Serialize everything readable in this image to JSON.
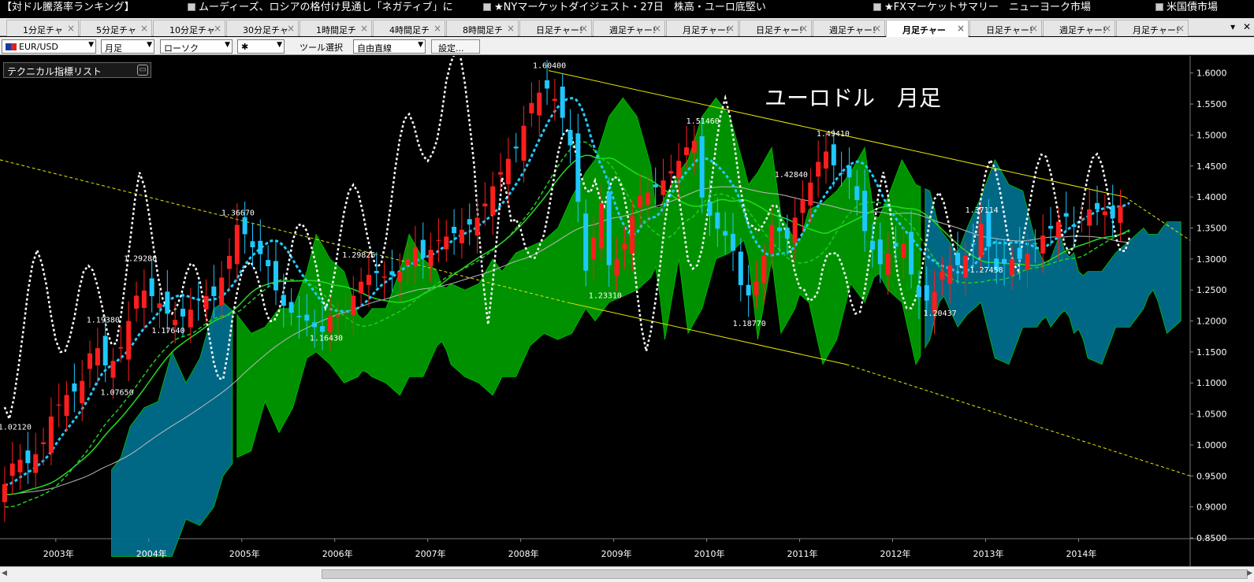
{
  "news": [
    {
      "text": "【対ドル騰落率ランキング】"
    },
    {
      "text": "ムーディーズ、ロシアの格付け見通し「ネガティブ」に"
    },
    {
      "text": "★NYマーケットダイジェスト・27日　株高・ユーロ底堅い"
    },
    {
      "text": "★FXマーケットサマリー　ニューヨーク市場"
    },
    {
      "text": "米国債市場"
    }
  ],
  "tabs": [
    {
      "label": "1分足チャ"
    },
    {
      "label": "5分足チャ"
    },
    {
      "label": "10分足チャ"
    },
    {
      "label": "30分足チャ"
    },
    {
      "label": "1時間足チ"
    },
    {
      "label": "4時間足チ"
    },
    {
      "label": "8時間足チ"
    },
    {
      "label": "日足チャー!"
    },
    {
      "label": "週足チャー!"
    },
    {
      "label": "月足チャー!"
    },
    {
      "label": "日足チャー!"
    },
    {
      "label": "週足チャー!"
    },
    {
      "label": "月足チャー"
    },
    {
      "label": "日足チャー!"
    },
    {
      "label": "週足チャー!"
    },
    {
      "label": "月足チャー!"
    }
  ],
  "active_tab": 12,
  "toolbar": {
    "pair": "EUR/USD",
    "timeframe": "月足",
    "chart_type": "ローソク",
    "marker": "✱",
    "tool_label": "ツール選択",
    "tool": "自由直線",
    "settings": "設定..."
  },
  "indicator_list": "テクニカル指標リスト",
  "chart_title": "ユーロドル　月足",
  "colors": {
    "bull": "#ff1e1e",
    "bear": "#1ec8ff",
    "cloud_green": "#009900",
    "cloud_teal": "#006e8c",
    "trendline": "#e6e600"
  },
  "chart_data": {
    "type": "candlestick",
    "symbol": "EUR/USD",
    "timeframe": "月足",
    "ylim": [
      0.85,
      1.62
    ],
    "x_range": [
      2002.4,
      2015.2
    ],
    "yticks": [
      "1.6000",
      "1.5500",
      "1.5000",
      "1.4500",
      "1.4000",
      "1.3500",
      "1.3000",
      "1.2500",
      "1.2000",
      "1.1500",
      "1.1000",
      "1.0500",
      "1.0000",
      "0.9500",
      "0.9000",
      "0.8500"
    ],
    "xticks": [
      "2003年",
      "2004年",
      "2005年",
      "2006年",
      "2007年",
      "2008年",
      "2009年",
      "2010年",
      "2011年",
      "2012年",
      "2013年",
      "2014年"
    ],
    "annotations": [
      {
        "label": "1.02120",
        "t": 2002.55,
        "v": 1.0212
      },
      {
        "label": "1.07650",
        "t": 2003.65,
        "v": 1.0765
      },
      {
        "label": "1.19380",
        "t": 2003.5,
        "v": 1.1938
      },
      {
        "label": "1.17640",
        "t": 2004.2,
        "v": 1.1764
      },
      {
        "label": "1.29280",
        "t": 2003.9,
        "v": 1.2928
      },
      {
        "label": "1.36670",
        "t": 2004.95,
        "v": 1.3667
      },
      {
        "label": "1.16430",
        "t": 2005.9,
        "v": 1.1643
      },
      {
        "label": "1.29826",
        "t": 2006.25,
        "v": 1.2983
      },
      {
        "label": "1.60400",
        "t": 2008.3,
        "v": 1.604
      },
      {
        "label": "1.23310",
        "t": 2008.9,
        "v": 1.2331
      },
      {
        "label": "1.51460",
        "t": 2009.95,
        "v": 1.5146
      },
      {
        "label": "1.18770",
        "t": 2010.45,
        "v": 1.1877
      },
      {
        "label": "1.42840",
        "t": 2010.9,
        "v": 1.4284
      },
      {
        "label": "1.49410",
        "t": 2011.35,
        "v": 1.4941
      },
      {
        "label": "1.20437",
        "t": 2012.5,
        "v": 1.2044
      },
      {
        "label": "1.37114",
        "t": 2012.95,
        "v": 1.3711
      },
      {
        "label": "1.27458",
        "t": 2013.0,
        "v": 1.2746
      }
    ],
    "close_path": [
      [
        2002.45,
        0.92
      ],
      [
        2002.6,
        0.98
      ],
      [
        2002.75,
        0.97
      ],
      [
        2002.9,
        1.0
      ],
      [
        2003.0,
        1.05
      ],
      [
        2003.15,
        1.08
      ],
      [
        2003.3,
        1.09
      ],
      [
        2003.45,
        1.17
      ],
      [
        2003.6,
        1.12
      ],
      [
        2003.75,
        1.16
      ],
      [
        2003.9,
        1.24
      ],
      [
        2004.0,
        1.25
      ],
      [
        2004.15,
        1.23
      ],
      [
        2004.3,
        1.2
      ],
      [
        2004.45,
        1.21
      ],
      [
        2004.6,
        1.24
      ],
      [
        2004.75,
        1.24
      ],
      [
        2004.9,
        1.3
      ],
      [
        2005.0,
        1.36
      ],
      [
        2005.15,
        1.32
      ],
      [
        2005.3,
        1.3
      ],
      [
        2005.45,
        1.23
      ],
      [
        2005.6,
        1.21
      ],
      [
        2005.75,
        1.2
      ],
      [
        2005.9,
        1.18
      ],
      [
        2006.0,
        1.21
      ],
      [
        2006.15,
        1.21
      ],
      [
        2006.3,
        1.26
      ],
      [
        2006.45,
        1.28
      ],
      [
        2006.6,
        1.27
      ],
      [
        2006.75,
        1.28
      ],
      [
        2006.9,
        1.32
      ],
      [
        2007.0,
        1.3
      ],
      [
        2007.15,
        1.33
      ],
      [
        2007.3,
        1.34
      ],
      [
        2007.45,
        1.35
      ],
      [
        2007.6,
        1.37
      ],
      [
        2007.75,
        1.42
      ],
      [
        2007.9,
        1.46
      ],
      [
        2008.0,
        1.48
      ],
      [
        2008.15,
        1.55
      ],
      [
        2008.3,
        1.58
      ],
      [
        2008.45,
        1.55
      ],
      [
        2008.6,
        1.47
      ],
      [
        2008.75,
        1.27
      ],
      [
        2008.9,
        1.4
      ],
      [
        2009.0,
        1.28
      ],
      [
        2009.15,
        1.32
      ],
      [
        2009.3,
        1.4
      ],
      [
        2009.45,
        1.41
      ],
      [
        2009.6,
        1.43
      ],
      [
        2009.75,
        1.46
      ],
      [
        2009.9,
        1.5
      ],
      [
        2010.0,
        1.39
      ],
      [
        2010.15,
        1.35
      ],
      [
        2010.3,
        1.33
      ],
      [
        2010.45,
        1.23
      ],
      [
        2010.6,
        1.27
      ],
      [
        2010.75,
        1.36
      ],
      [
        2010.9,
        1.33
      ],
      [
        2011.0,
        1.37
      ],
      [
        2011.15,
        1.42
      ],
      [
        2011.3,
        1.48
      ],
      [
        2011.45,
        1.44
      ],
      [
        2011.6,
        1.43
      ],
      [
        2011.75,
        1.34
      ],
      [
        2011.9,
        1.29
      ],
      [
        2012.0,
        1.31
      ],
      [
        2012.15,
        1.33
      ],
      [
        2012.3,
        1.24
      ],
      [
        2012.45,
        1.23
      ],
      [
        2012.6,
        1.29
      ],
      [
        2012.75,
        1.29
      ],
      [
        2012.9,
        1.32
      ],
      [
        2013.0,
        1.36
      ],
      [
        2013.15,
        1.28
      ],
      [
        2013.3,
        1.3
      ],
      [
        2013.45,
        1.3
      ],
      [
        2013.6,
        1.33
      ],
      [
        2013.75,
        1.35
      ],
      [
        2013.9,
        1.37
      ],
      [
        2014.0,
        1.35
      ],
      [
        2014.15,
        1.38
      ],
      [
        2014.3,
        1.38
      ],
      [
        2014.45,
        1.36
      ],
      [
        2014.5,
        1.39
      ]
    ]
  }
}
